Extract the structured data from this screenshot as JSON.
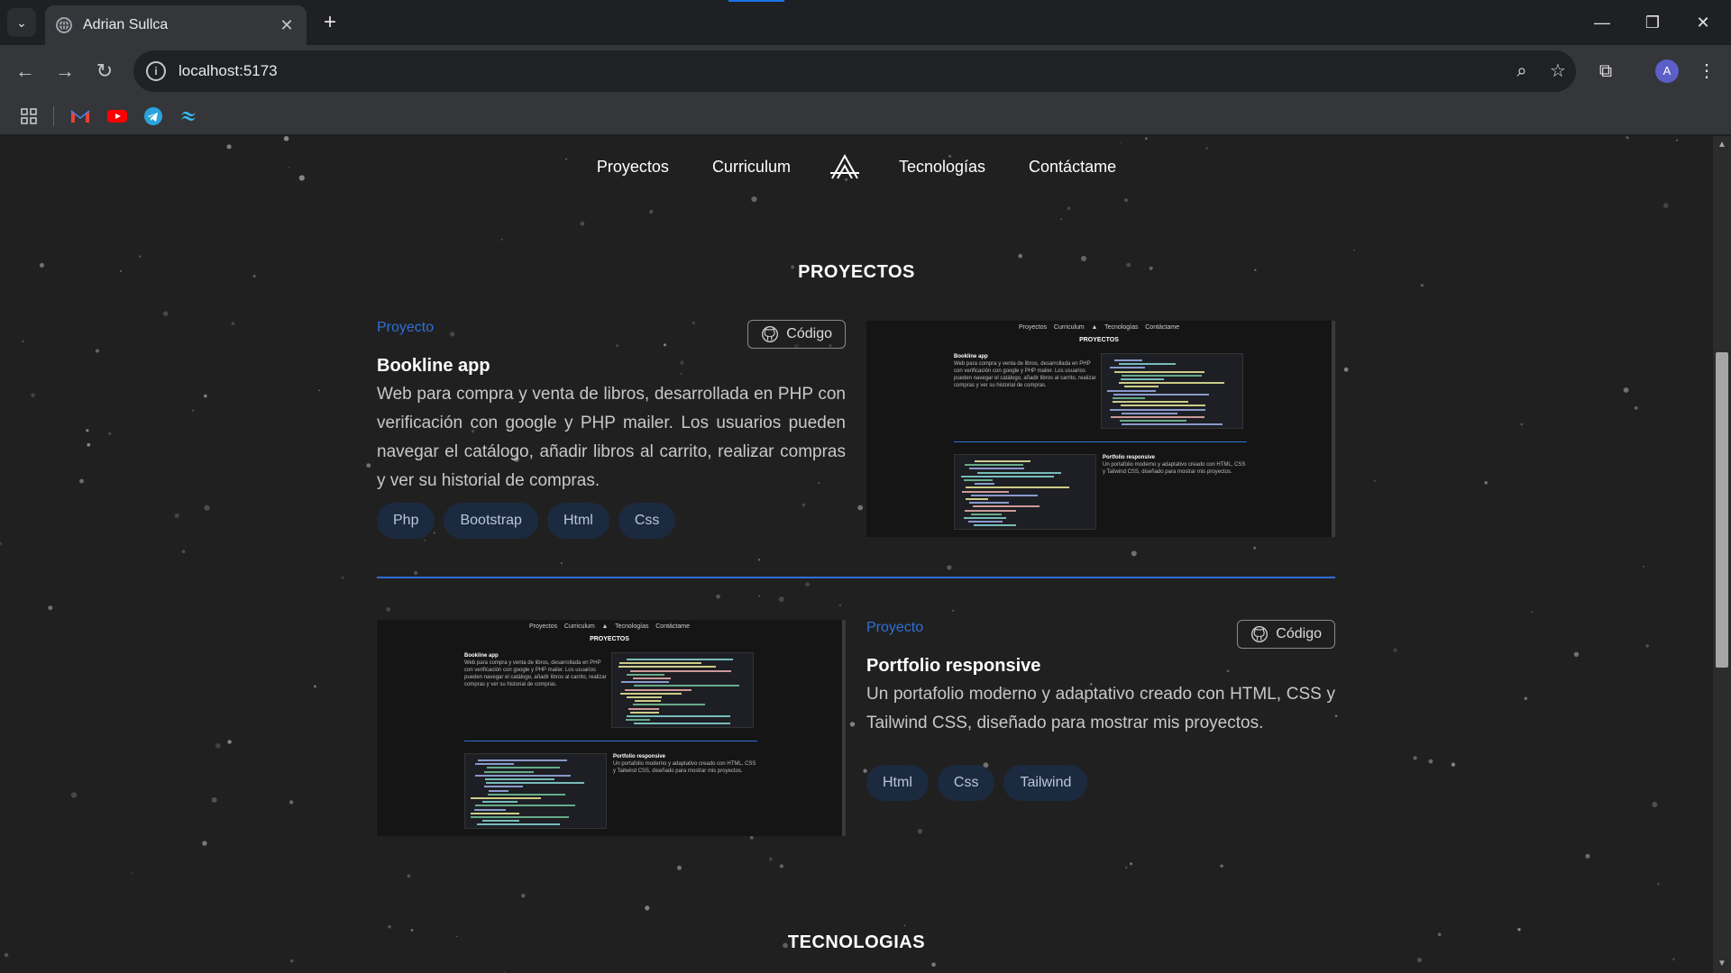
{
  "browser": {
    "tab_title": "Adrian Sullca",
    "url": "localhost:5173",
    "avatar_letter": "A",
    "accent_color": "#1a73e8"
  },
  "site_nav": {
    "items": [
      "Proyectos",
      "Curriculum",
      "Tecnologías",
      "Contáctame"
    ]
  },
  "sections": {
    "proyectos": "PROYECTOS",
    "tecnologias": "TECNOLOGIAS"
  },
  "projects": [
    {
      "label": "Proyecto",
      "code_button": "Código",
      "title": "Bookline app",
      "description": "Web para compra y venta de libros, desarrollada en PHP con verificación con google y PHP mailer. Los usuarios pueden navegar el catálogo, añadir libros al carrito, realizar compras y ver su historial de compras.",
      "tags": [
        "Php",
        "Bootstrap",
        "Html",
        "Css"
      ]
    },
    {
      "label": "Proyecto",
      "code_button": "Código",
      "title": "Portfolio responsive",
      "description": "Un portafolio moderno y adaptativo creado con HTML, CSS y Tailwind CSS, diseñado para mostrar mis proyectos.",
      "tags": [
        "Html",
        "Css",
        "Tailwind"
      ]
    }
  ],
  "colors": {
    "page_bg": "#202020",
    "link_blue": "#2f6fd6",
    "tag_bg": "#1c2a3f"
  }
}
